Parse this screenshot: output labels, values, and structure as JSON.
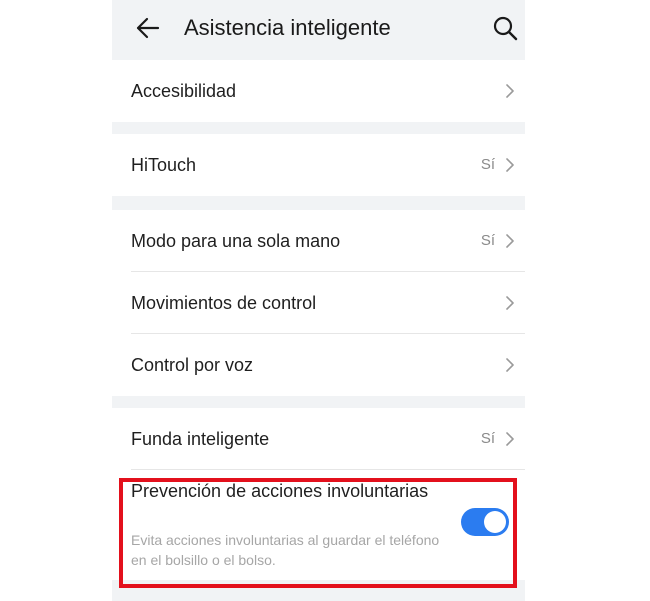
{
  "header": {
    "title": "Asistencia inteligente",
    "back_icon": "arrow-left-icon",
    "search_icon": "search-icon"
  },
  "groups": [
    {
      "items": [
        {
          "label": "Accesibilidad",
          "value": ""
        }
      ]
    },
    {
      "items": [
        {
          "label": "HiTouch",
          "value": "Sí"
        }
      ]
    },
    {
      "items": [
        {
          "label": "Modo para una sola mano",
          "value": "Sí"
        },
        {
          "label": "Movimientos de control",
          "value": ""
        },
        {
          "label": "Control por voz",
          "value": ""
        }
      ]
    },
    {
      "items": [
        {
          "label": "Funda inteligente",
          "value": "Sí"
        }
      ]
    }
  ],
  "toggle": {
    "label": "Prevención de acciones involuntarias",
    "description": "Evita acciones involuntarias al guardar el teléfono en el bolsillo o el bolso.",
    "state": "on"
  },
  "colors": {
    "accent": "#2b7cf0",
    "highlight": "#e3101c",
    "background": "#f1f3f5"
  }
}
